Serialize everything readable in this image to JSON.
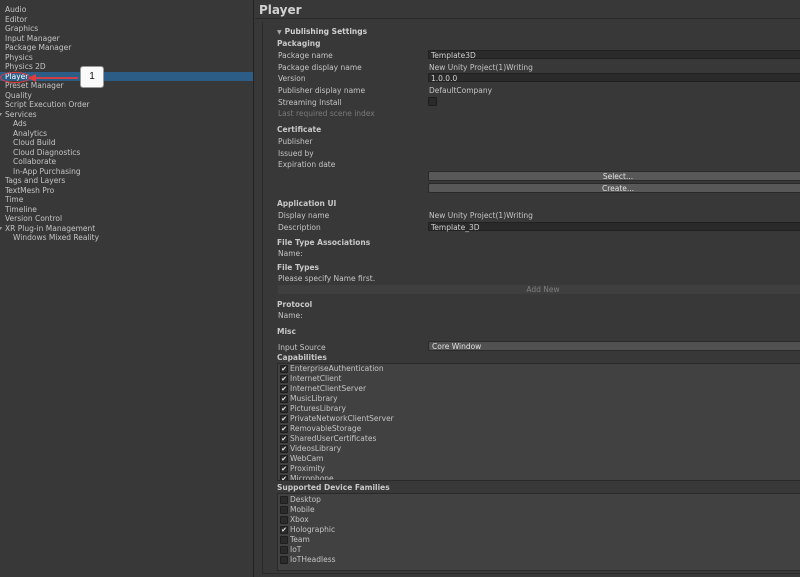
{
  "sidebar": {
    "items": [
      {
        "label": "Audio",
        "level": 0
      },
      {
        "label": "Editor",
        "level": 0
      },
      {
        "label": "Graphics",
        "level": 0
      },
      {
        "label": "Input Manager",
        "level": 0
      },
      {
        "label": "Package Manager",
        "level": 0
      },
      {
        "label": "Physics",
        "level": 0
      },
      {
        "label": "Physics 2D",
        "level": 0
      },
      {
        "label": "Player",
        "level": 0,
        "selected": true
      },
      {
        "label": "Preset Manager",
        "level": 0
      },
      {
        "label": "Quality",
        "level": 0
      },
      {
        "label": "Script Execution Order",
        "level": 0
      },
      {
        "label": "Services",
        "level": 0,
        "foldout": true
      },
      {
        "label": "Ads",
        "level": 1
      },
      {
        "label": "Analytics",
        "level": 1
      },
      {
        "label": "Cloud Build",
        "level": 1
      },
      {
        "label": "Cloud Diagnostics",
        "level": 1
      },
      {
        "label": "Collaborate",
        "level": 1
      },
      {
        "label": "In-App Purchasing",
        "level": 1
      },
      {
        "label": "Tags and Layers",
        "level": 0
      },
      {
        "label": "TextMesh Pro",
        "level": 0
      },
      {
        "label": "Time",
        "level": 0
      },
      {
        "label": "Timeline",
        "level": 0
      },
      {
        "label": "Version Control",
        "level": 0
      },
      {
        "label": "XR Plug-in Management",
        "level": 0,
        "foldout": true
      },
      {
        "label": "Windows Mixed Reality",
        "level": 1
      }
    ]
  },
  "annotation": {
    "badge": "1",
    "color": "#e33b3b"
  },
  "page": {
    "title": "Player"
  },
  "publishing": {
    "title": "Publishing Settings",
    "packaging": {
      "header": "Packaging",
      "package_name_label": "Package name",
      "package_name": "Template3D",
      "display_name_label": "Package display name",
      "display_name": "New Unity Project(1)Writing",
      "version_label": "Version",
      "version": "1.0.0.0",
      "publisher_label": "Publisher display name",
      "publisher": "DefaultCompany",
      "streaming_label": "Streaming Install",
      "last_scene_label": "Last required scene index"
    },
    "certificate": {
      "header": "Certificate",
      "publisher_label": "Publisher",
      "issued_label": "Issued by",
      "expiration_label": "Expiration date",
      "select_button": "Select...",
      "create_button": "Create..."
    },
    "app_ui": {
      "header": "Application UI",
      "display_name_label": "Display name",
      "display_name": "New Unity Project(1)Writing",
      "description_label": "Description",
      "description": "Template_3D"
    },
    "file_type_assoc": {
      "header": "File Type Associations",
      "name_label": "Name:"
    },
    "file_types": {
      "header": "File Types",
      "message": "Please specify Name first.",
      "add_new": "Add New"
    },
    "protocol": {
      "header": "Protocol",
      "name_label": "Name:"
    },
    "misc": {
      "header": "Misc"
    },
    "input_source": {
      "label": "Input Source",
      "value": "Core Window"
    },
    "capabilities": {
      "header": "Capabilities",
      "items": [
        {
          "label": "EnterpriseAuthentication",
          "checked": true
        },
        {
          "label": "InternetClient",
          "checked": true
        },
        {
          "label": "InternetClientServer",
          "checked": true
        },
        {
          "label": "MusicLibrary",
          "checked": true
        },
        {
          "label": "PicturesLibrary",
          "checked": true
        },
        {
          "label": "PrivateNetworkClientServer",
          "checked": true
        },
        {
          "label": "RemovableStorage",
          "checked": true
        },
        {
          "label": "SharedUserCertificates",
          "checked": true
        },
        {
          "label": "VideosLibrary",
          "checked": true
        },
        {
          "label": "WebCam",
          "checked": true
        },
        {
          "label": "Proximity",
          "checked": true
        },
        {
          "label": "Microphone",
          "checked": true
        }
      ]
    },
    "device_families": {
      "header": "Supported Device Families",
      "items": [
        {
          "label": "Desktop",
          "checked": false
        },
        {
          "label": "Mobile",
          "checked": false
        },
        {
          "label": "Xbox",
          "checked": false
        },
        {
          "label": "Holographic",
          "checked": true
        },
        {
          "label": "Team",
          "checked": false
        },
        {
          "label": "IoT",
          "checked": false
        },
        {
          "label": "IoTHeadless",
          "checked": false
        }
      ]
    }
  }
}
